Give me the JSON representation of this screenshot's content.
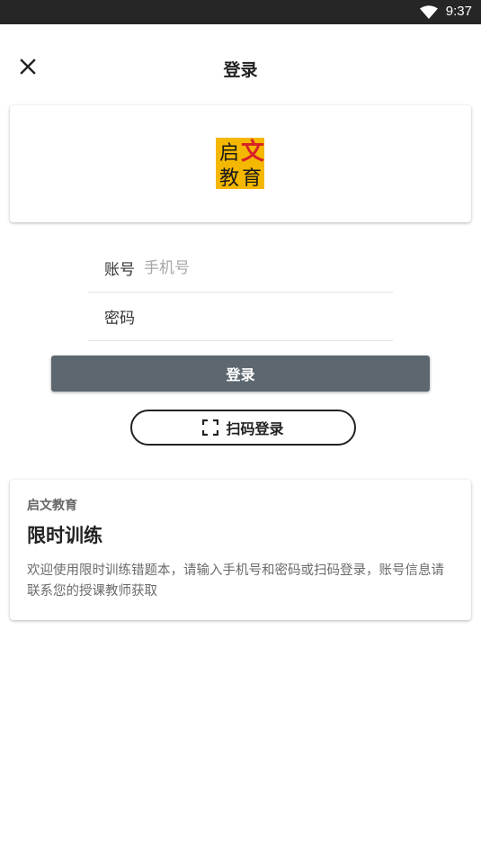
{
  "status_bar": {
    "time": "9:37",
    "wifi_icon": "wifi-icon"
  },
  "header": {
    "title": "登录",
    "close_icon": "close-icon"
  },
  "logo": {
    "chars": [
      "启",
      "文",
      "教",
      "育"
    ],
    "colors": {
      "background": "#f5b800",
      "accent": "#d8202a",
      "text": "#1a1a1a"
    }
  },
  "form": {
    "account_label": "账号",
    "account_placeholder": "手机号",
    "account_value": "",
    "password_label": "密码",
    "password_value": "",
    "login_button": "登录",
    "scan_button": "扫码登录"
  },
  "info_card": {
    "org": "启文教育",
    "title": "限时训练",
    "description": "欢迎使用限时训练错题本，请输入手机号和密码或扫码登录，账号信息请联系您的授课教师获取"
  },
  "colors": {
    "login_button_bg": "#5c6770",
    "status_bar_bg": "#262626"
  }
}
